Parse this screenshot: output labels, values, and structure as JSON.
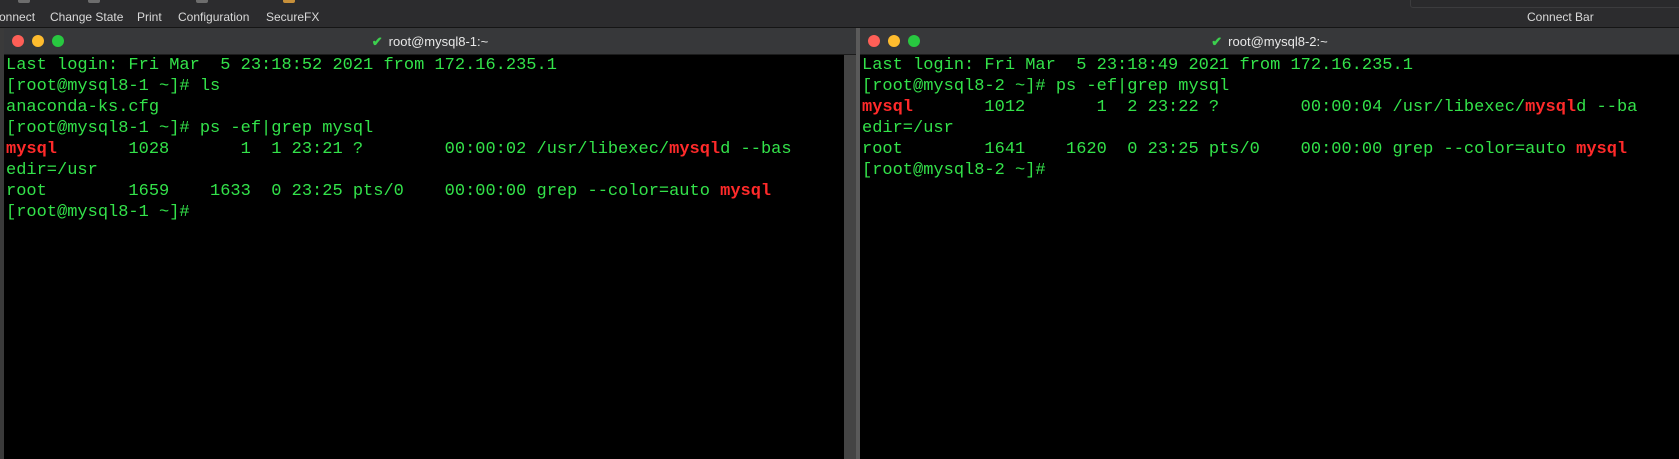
{
  "toolbar": {
    "items": [
      "onnect",
      "Change State",
      "Print",
      "Configuration",
      "SecureFX"
    ],
    "connect_bar_label": "Connect Bar"
  },
  "panes": [
    {
      "title": "root@mysql8-1:~",
      "lines": [
        [
          {
            "t": "Last login: Fri Mar  5 23:18:52 2021 from 172.16.235.1"
          }
        ],
        [
          {
            "t": "[root@mysql8-1 ~]# ls"
          }
        ],
        [
          {
            "t": "anaconda-ks.cfg"
          }
        ],
        [
          {
            "t": "[root@mysql8-1 ~]# ps -ef|grep mysql"
          }
        ],
        [
          {
            "t": "mysql",
            "hl": true
          },
          {
            "t": "       1028       1  1 23:21 ?        00:00:02 /usr/libexec/"
          },
          {
            "t": "mysql",
            "hl": true
          },
          {
            "t": "d --bas"
          }
        ],
        [
          {
            "t": "edir=/usr"
          }
        ],
        [
          {
            "t": "root        1659    1633  0 23:25 pts/0    00:00:00 grep --color=auto "
          },
          {
            "t": "mysql",
            "hl": true
          }
        ],
        [
          {
            "t": "[root@mysql8-1 ~]#"
          }
        ]
      ]
    },
    {
      "title": "root@mysql8-2:~",
      "lines": [
        [
          {
            "t": "Last login: Fri Mar  5 23:18:49 2021 from 172.16.235.1"
          }
        ],
        [
          {
            "t": "[root@mysql8-2 ~]# ps -ef|grep mysql"
          }
        ],
        [
          {
            "t": "mysql",
            "hl": true
          },
          {
            "t": "       1012       1  2 23:22 ?        00:00:04 /usr/libexec/"
          },
          {
            "t": "mysql",
            "hl": true
          },
          {
            "t": "d --ba"
          }
        ],
        [
          {
            "t": "edir=/usr"
          }
        ],
        [
          {
            "t": "root        1641    1620  0 23:25 pts/0    00:00:00 grep --color=auto "
          },
          {
            "t": "mysql",
            "hl": true
          }
        ],
        [
          {
            "t": "[root@mysql8-2 ~]#"
          }
        ]
      ]
    }
  ],
  "colors": {
    "terminal_text": "#33e24a",
    "terminal_highlight": "#ff2a2a",
    "terminal_bg": "#000000"
  },
  "icons": {
    "title_status": "check-icon"
  }
}
